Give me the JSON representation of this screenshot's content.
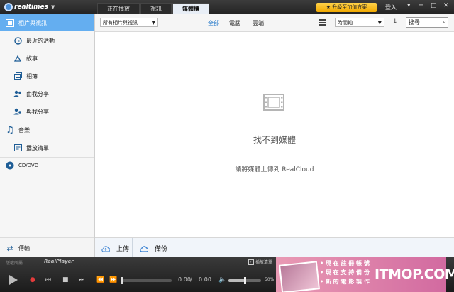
{
  "app": {
    "logo_text": "realtimes",
    "upgrade_label": "升級至加值方案",
    "signin_label": "登入"
  },
  "tabs": [
    {
      "label": "正在播放",
      "active": false
    },
    {
      "label": "視訊",
      "active": false
    },
    {
      "label": "媒體櫃",
      "active": true
    }
  ],
  "sidebar": {
    "items": [
      {
        "label": "相片與視訊",
        "icon": "photos-videos-icon",
        "selected": true
      },
      {
        "label": "最近的活動",
        "icon": "clock-icon"
      },
      {
        "label": "故事",
        "icon": "story-icon"
      },
      {
        "label": "相簿",
        "icon": "album-icon"
      },
      {
        "label": "由我分享",
        "icon": "shared-by-me-icon"
      },
      {
        "label": "與我分享",
        "icon": "shared-with-me-icon"
      },
      {
        "label": "音樂",
        "icon": "music-note-icon"
      },
      {
        "label": "播放清單",
        "icon": "playlist-icon"
      },
      {
        "label": "CD/DVD",
        "icon": "disc-icon"
      }
    ],
    "footer_label": "傳輸"
  },
  "toolbar": {
    "filter_dropdown": "所有相片與視訊",
    "filters": [
      {
        "label": "全部",
        "active": true
      },
      {
        "label": "電腦",
        "active": false
      },
      {
        "label": "雲端",
        "active": false
      }
    ],
    "sort_dropdown": "時間軸",
    "search_placeholder": "搜尋"
  },
  "main": {
    "empty_title": "找不到媒體",
    "empty_subtitle": "請將媒體上傳到 RealCloud"
  },
  "actionbar": {
    "upload_label": "上傳",
    "backup_label": "備份"
  },
  "player": {
    "brand_text": "版權所屬",
    "player_logo": "RealPlayer",
    "playlist_label": "播放清單",
    "time_current": "0:00",
    "time_total": "0:00",
    "volume_percent": "50%",
    "volume_level": 0.5
  },
  "ad": {
    "lines": [
      "• 現 在 註 冊 帳 號",
      "• 現 在 支 持 備 份",
      "• 新 的 電 影 製 作"
    ],
    "watermark": "ITMOP.COM"
  },
  "colors": {
    "accent": "#64aef0",
    "link": "#1a73c8",
    "upgrade": "#f5b800"
  }
}
